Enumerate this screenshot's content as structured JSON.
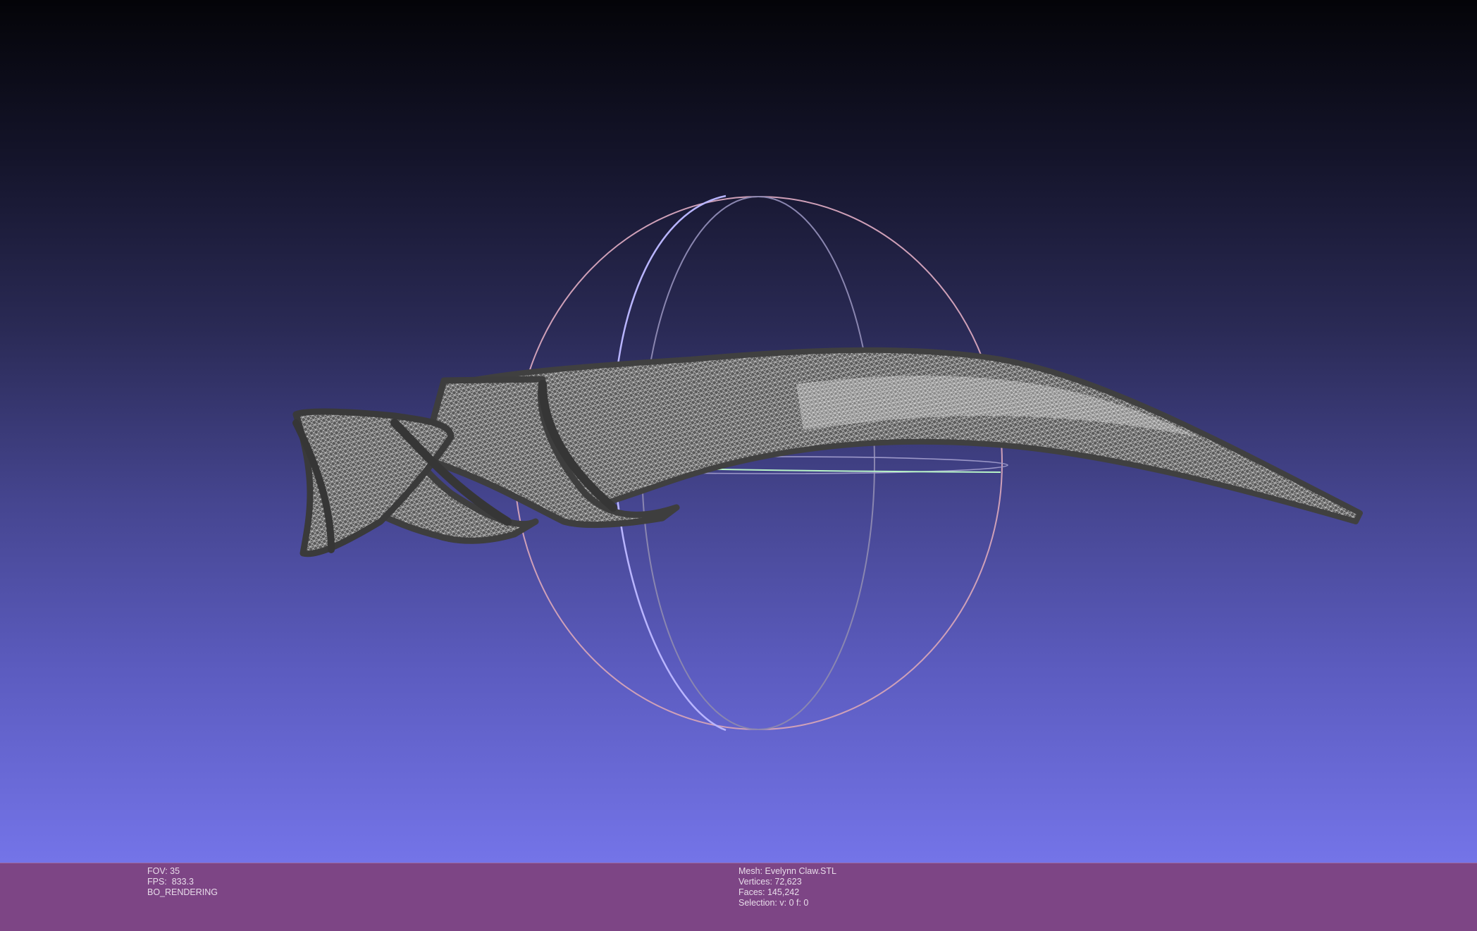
{
  "viewport": {
    "background_top": "#040408",
    "background_bottom": "#7474e8",
    "mesh_color": "#4a4a4a",
    "wire_color": "#d8d8d8",
    "trackball": {
      "x_ring_color": "#8a86b0",
      "y_ring_color": "#b9b5ff",
      "z_ring_color": "#cfa0b8",
      "axis_line_color": "#b8f5c8"
    }
  },
  "info_left": {
    "fov": "FOV: 35",
    "fps": "FPS:  833.3",
    "rendering": "BO_RENDERING"
  },
  "info_right": {
    "mesh": "Mesh: Evelynn Claw.STL",
    "vertices": "Vertices: 72,623",
    "faces": "Faces: 145,242",
    "selection": "Selection: v: 0 f: 0"
  }
}
